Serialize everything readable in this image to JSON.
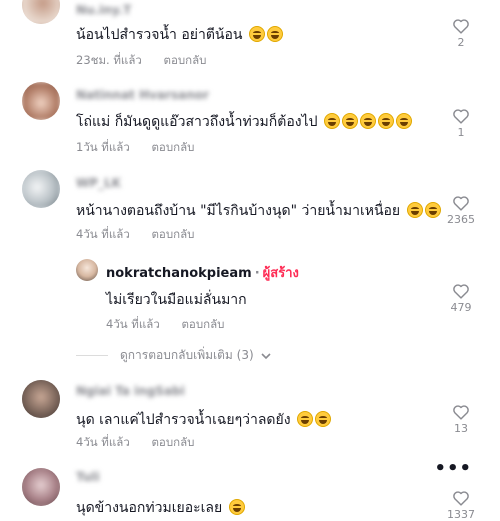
{
  "comments": [
    {
      "username": "Nu.iny.T",
      "text": "น้อนไปสำรวจน้ำ อย่าตีน้อน",
      "emojis": 2,
      "time": "23ชม. ที่แล้ว",
      "reply": "ตอบกลับ",
      "likes": "2"
    },
    {
      "username": "Natinnat Hvarsanor",
      "text": "โถ่แม่ ก็มันดูดูแอ๊วสาวถึงน้ำท่วมก็ต้องไป",
      "emojis": 5,
      "time": "1วัน ที่แล้ว",
      "reply": "ตอบกลับ",
      "likes": "1"
    },
    {
      "username": "WP_LK",
      "text": "หน้านางตอนถึงบ้าน \"มีไรกินบ้างนุด\" ว่ายน้ำมาเหนื่อย",
      "emojis": 2,
      "time": "4วัน ที่แล้ว",
      "reply": "ตอบกลับ",
      "likes": "2365"
    },
    {
      "username": "Ngiai Ta ingSabi",
      "text": "นุด เลาแค่ไปสำรวจน้ำเฉยๆว่าลดยัง",
      "emojis": 2,
      "time": "4วัน ที่แล้ว",
      "reply": "ตอบกลับ",
      "likes": "13"
    },
    {
      "username": "Tuli",
      "text": "นุดข้างนอกท่วมเยอะเลย",
      "emojis": 1,
      "time": "",
      "reply": "",
      "likes": "1337"
    }
  ],
  "author_reply": {
    "username": "nokratchanokpieam",
    "separator": "·",
    "badge": "ผู้สร้าง",
    "text": "ไม่เรียวในมือแม่ลั่นมาก",
    "time": "4วัน ที่แล้ว",
    "reply": "ตอบกลับ",
    "likes": "479"
  },
  "more_replies": {
    "label": "ดูการตอบกลับเพิ่มเติม (3)"
  },
  "colors": {
    "text": "#161823",
    "muted": "#8a8b91",
    "creator": "#fe2c55"
  }
}
